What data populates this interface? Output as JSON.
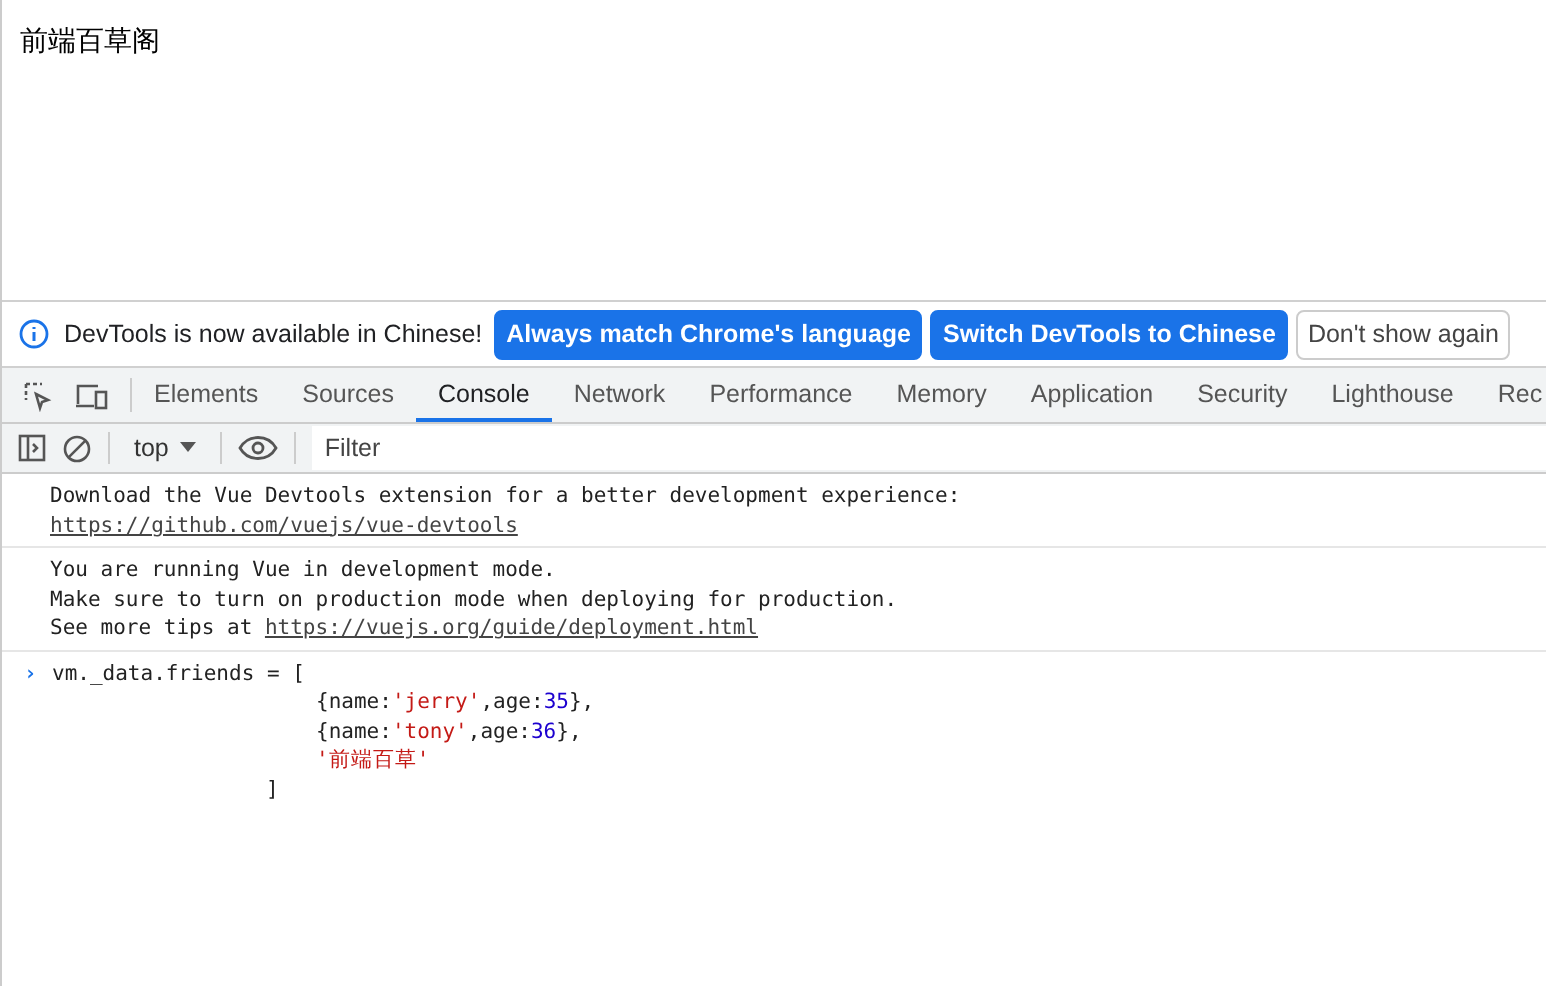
{
  "page": {
    "heading": "前端百草阁"
  },
  "infobar": {
    "message": "DevTools is now available in Chinese!",
    "buttons": [
      {
        "label": "Always match Chrome's language",
        "kind": "primary"
      },
      {
        "label": "Switch DevTools to Chinese",
        "kind": "primary"
      },
      {
        "label": "Don't show again",
        "kind": "plain"
      }
    ]
  },
  "tabs": [
    {
      "label": "Elements",
      "selected": false
    },
    {
      "label": "Sources",
      "selected": false
    },
    {
      "label": "Console",
      "selected": true
    },
    {
      "label": "Network",
      "selected": false
    },
    {
      "label": "Performance",
      "selected": false
    },
    {
      "label": "Memory",
      "selected": false
    },
    {
      "label": "Application",
      "selected": false
    },
    {
      "label": "Security",
      "selected": false
    },
    {
      "label": "Lighthouse",
      "selected": false
    },
    {
      "label": "Rec",
      "selected": false
    }
  ],
  "console_toolbar": {
    "context": "top",
    "filter_placeholder": "Filter"
  },
  "messages": [
    {
      "lines": [
        "Download the Vue Devtools extension for a better development experience:"
      ],
      "link": "https://github.com/vuejs/vue-devtools"
    },
    {
      "lines": [
        "You are running Vue in development mode.",
        "Make sure to turn on production mode when deploying for production."
      ],
      "link_prefix": "See more tips at ",
      "link": "https://vuejs.org/guide/deployment.html"
    }
  ],
  "input": {
    "prompt": "›",
    "lines": [
      {
        "kind": "head",
        "tokens": [
          {
            "text": "vm._data.friends = [",
            "kind": "plain"
          }
        ]
      },
      {
        "kind": "item",
        "tokens": [
          {
            "text": "{name:",
            "kind": "plain"
          },
          {
            "text": "'jerry'",
            "kind": "string"
          },
          {
            "text": ",age:",
            "kind": "plain"
          },
          {
            "text": "35",
            "kind": "number"
          },
          {
            "text": "},",
            "kind": "plain"
          }
        ]
      },
      {
        "kind": "item",
        "tokens": [
          {
            "text": "{name:",
            "kind": "plain"
          },
          {
            "text": "'tony'",
            "kind": "string"
          },
          {
            "text": ",age:",
            "kind": "plain"
          },
          {
            "text": "36",
            "kind": "number"
          },
          {
            "text": "},",
            "kind": "plain"
          }
        ]
      },
      {
        "kind": "item",
        "tokens": [
          {
            "text": "'前端百草'",
            "kind": "string"
          }
        ]
      },
      {
        "kind": "close",
        "tokens": [
          {
            "text": "]",
            "kind": "plain"
          }
        ]
      }
    ]
  }
}
